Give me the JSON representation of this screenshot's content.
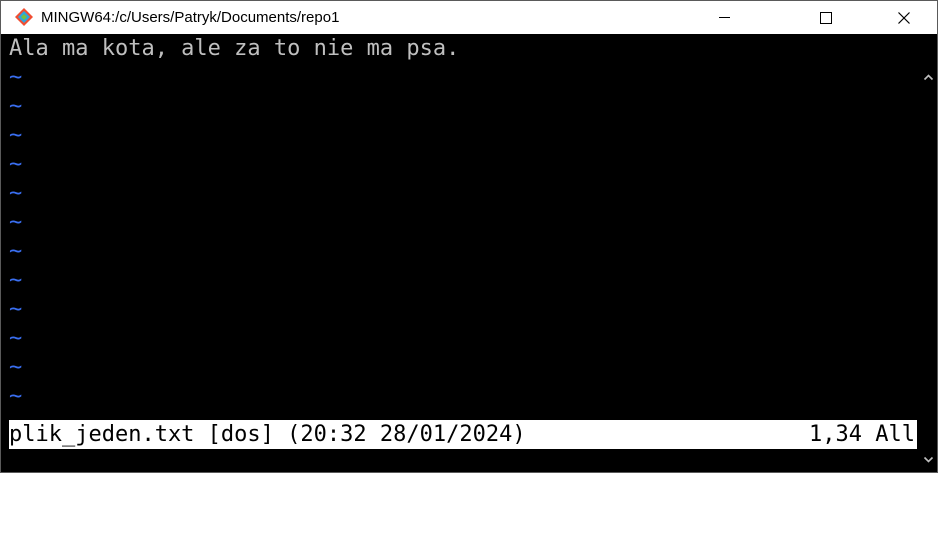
{
  "window": {
    "title": "MINGW64:/c/Users/Patryk/Documents/repo1",
    "icon": "git-bash-diamond-icon"
  },
  "editor": {
    "lines": [
      "Ala ma kota, ale za to nie ma psa."
    ],
    "empty_line_marker": "~",
    "empty_line_count": 11
  },
  "statusline": {
    "file_info": "plik_jeden.txt [dos] (20:32 28/01/2024)",
    "position": "1,34 All"
  },
  "colors": {
    "background": "#000000",
    "text": "#bfbfbf",
    "tilde": "#3a6ff2",
    "statusline_bg": "#ffffff",
    "statusline_fg": "#000000"
  }
}
